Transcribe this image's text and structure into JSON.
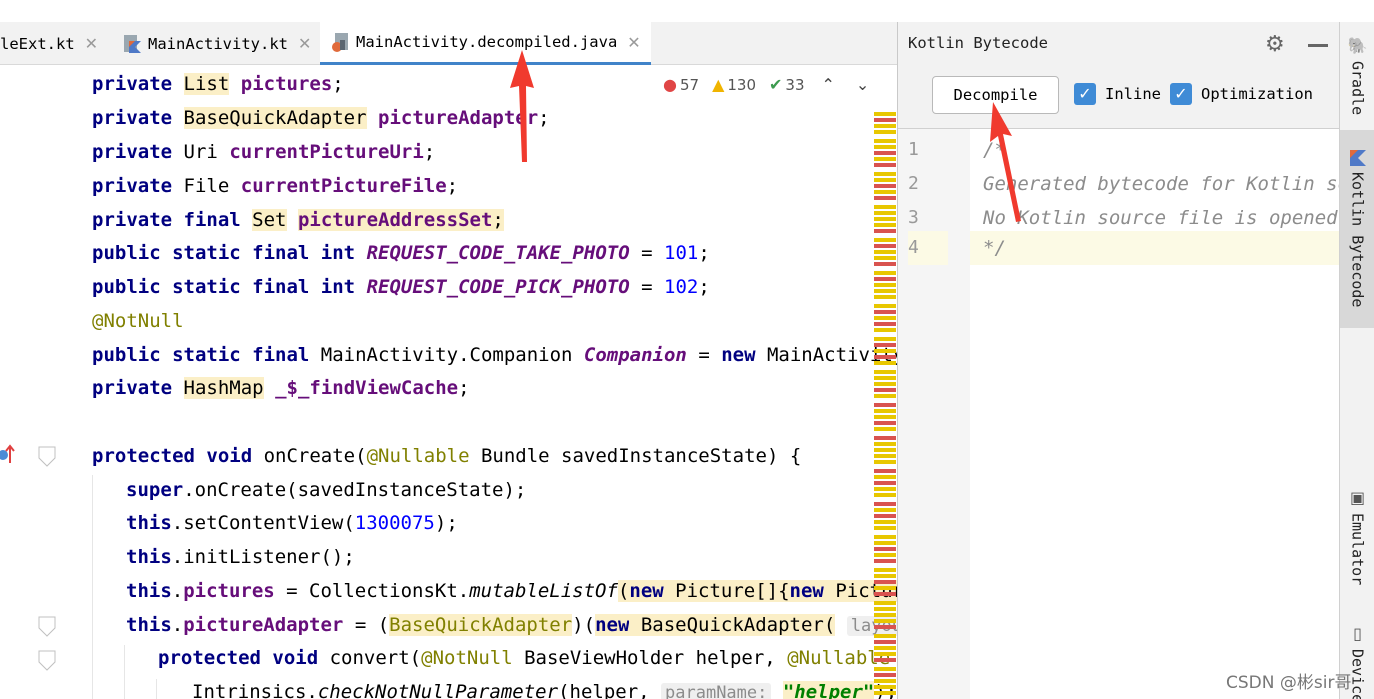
{
  "tabs": [
    {
      "label": "leExt.kt",
      "active": false
    },
    {
      "label": "MainActivity.kt",
      "active": false
    },
    {
      "label": "MainActivity.decompiled.java",
      "active": true
    }
  ],
  "inspections": {
    "errors": "57",
    "warnings": "130",
    "typos": "33"
  },
  "code": {
    "l1": [
      "private",
      "List",
      "pictures",
      ";"
    ],
    "l2": [
      "private",
      "BaseQuickAdapter",
      "pictureAdapter",
      ";"
    ],
    "l3": [
      "private",
      "Uri",
      "currentPictureUri",
      ";"
    ],
    "l4": [
      "private",
      "File",
      "currentPictureFile",
      ";"
    ],
    "l5": [
      "private final",
      "Set",
      "pictureAddressSet",
      ";"
    ],
    "l6": [
      "public static final int",
      "REQUEST_CODE_TAKE_PHOTO",
      " = ",
      "101",
      ";"
    ],
    "l7": [
      "public static final int",
      "REQUEST_CODE_PICK_PHOTO",
      " = ",
      "102",
      ";"
    ],
    "l8": [
      "@NotNull"
    ],
    "l9": [
      "public static final",
      "MainActivity.Companion",
      "Companion",
      " = ",
      "new",
      "MainActivity"
    ],
    "l10": [
      "private",
      "HashMap",
      "_$_findViewCache",
      ";"
    ],
    "l11": [
      "protected void",
      "onCreate(",
      "@Nullable",
      "Bundle savedInstanceState) {"
    ],
    "l12": [
      "super",
      ".onCreate(savedInstanceState);"
    ],
    "l13": [
      "this",
      ".setContentView(",
      "1300075",
      ");"
    ],
    "l14": [
      "this",
      ".initListener();"
    ],
    "l15": [
      "this",
      ".",
      "pictures",
      " = CollectionsKt.",
      "mutableListOf",
      "(",
      "new",
      "Picture[]{",
      "new",
      "Picture"
    ],
    "l16": [
      "this",
      ".",
      "pictureAdapter",
      " = (",
      "BaseQuickAdapter",
      ")(",
      "new",
      "BaseQuickAdapter(",
      "layou"
    ],
    "l17": [
      "protected void",
      "convert(",
      "@NotNull",
      "BaseViewHolder helper, ",
      "@Nullable"
    ],
    "l18": [
      "Intrinsics.",
      "checkNotNullParameter",
      "(helper, ",
      "paramName:",
      "\"helper\"",
      ");"
    ]
  },
  "bytecode_panel": {
    "title": "Kotlin Bytecode",
    "decompile_label": "Decompile",
    "inline_label": "Inline",
    "optimization_label": "Optimization",
    "inline_checked": true,
    "optimization_checked": true,
    "line_numbers": [
      "1",
      "2",
      "3",
      "4"
    ],
    "lines": [
      "/*",
      "Generated bytecode for Kotlin source",
      "No Kotlin source file is opened.",
      "*/"
    ]
  },
  "tool_windows": [
    "Gradle",
    "Kotlin Bytecode",
    "Emulator",
    "Device"
  ],
  "watermark": "CSDN @彬sir哥",
  "colors": {
    "accent": "#4083c9",
    "keyword": "#000080",
    "field": "#660e7a",
    "number": "#0000ff",
    "annotation": "#808000",
    "highlight": "#fbefc7",
    "arrow": "#f03a2e"
  }
}
